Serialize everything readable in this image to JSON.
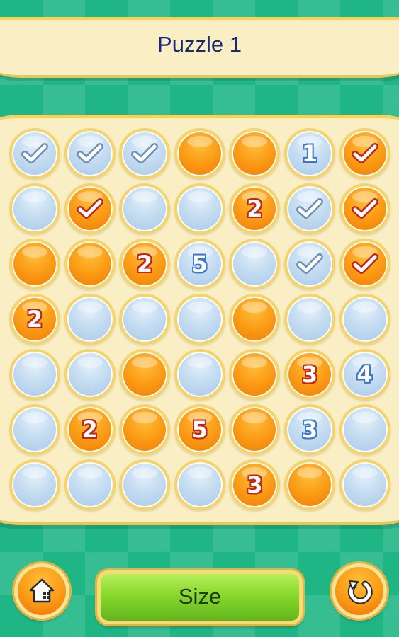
{
  "header": {
    "title": "Puzzle 1"
  },
  "board": {
    "rows": [
      [
        {
          "color": "blue",
          "mark": "check"
        },
        {
          "color": "blue",
          "mark": "check"
        },
        {
          "color": "blue",
          "mark": "check"
        },
        {
          "color": "orange",
          "mark": ""
        },
        {
          "color": "orange",
          "mark": ""
        },
        {
          "color": "blue",
          "mark": "1"
        },
        {
          "color": "orange",
          "mark": "check"
        }
      ],
      [
        {
          "color": "blue",
          "mark": ""
        },
        {
          "color": "orange",
          "mark": "check"
        },
        {
          "color": "blue",
          "mark": ""
        },
        {
          "color": "blue",
          "mark": ""
        },
        {
          "color": "orange",
          "mark": "2"
        },
        {
          "color": "blue",
          "mark": "check"
        },
        {
          "color": "orange",
          "mark": "check"
        }
      ],
      [
        {
          "color": "orange",
          "mark": ""
        },
        {
          "color": "orange",
          "mark": ""
        },
        {
          "color": "orange",
          "mark": "2"
        },
        {
          "color": "blue",
          "mark": "5"
        },
        {
          "color": "blue",
          "mark": ""
        },
        {
          "color": "blue",
          "mark": "check"
        },
        {
          "color": "orange",
          "mark": "check"
        }
      ],
      [
        {
          "color": "orange",
          "mark": "2"
        },
        {
          "color": "blue",
          "mark": ""
        },
        {
          "color": "blue",
          "mark": ""
        },
        {
          "color": "blue",
          "mark": ""
        },
        {
          "color": "orange",
          "mark": ""
        },
        {
          "color": "blue",
          "mark": ""
        },
        {
          "color": "blue",
          "mark": ""
        }
      ],
      [
        {
          "color": "blue",
          "mark": ""
        },
        {
          "color": "blue",
          "mark": ""
        },
        {
          "color": "orange",
          "mark": ""
        },
        {
          "color": "blue",
          "mark": ""
        },
        {
          "color": "orange",
          "mark": ""
        },
        {
          "color": "orange",
          "mark": "3"
        },
        {
          "color": "blue",
          "mark": "4"
        }
      ],
      [
        {
          "color": "blue",
          "mark": ""
        },
        {
          "color": "orange",
          "mark": "2"
        },
        {
          "color": "orange",
          "mark": ""
        },
        {
          "color": "orange",
          "mark": "5"
        },
        {
          "color": "orange",
          "mark": ""
        },
        {
          "color": "blue",
          "mark": "3"
        },
        {
          "color": "blue",
          "mark": ""
        }
      ],
      [
        {
          "color": "blue",
          "mark": ""
        },
        {
          "color": "blue",
          "mark": ""
        },
        {
          "color": "blue",
          "mark": ""
        },
        {
          "color": "blue",
          "mark": ""
        },
        {
          "color": "orange",
          "mark": "3"
        },
        {
          "color": "orange",
          "mark": ""
        },
        {
          "color": "blue",
          "mark": ""
        }
      ]
    ]
  },
  "footer": {
    "home_icon": "home-icon",
    "size_label": "Size",
    "restart_icon": "restart-icon"
  },
  "colors": {
    "background": "#1fb585",
    "panel": "#faeec4",
    "orange": "#fb9a14",
    "blue": "#c4dcf1",
    "green": "#86d62b",
    "title": "#1a2a7a"
  }
}
